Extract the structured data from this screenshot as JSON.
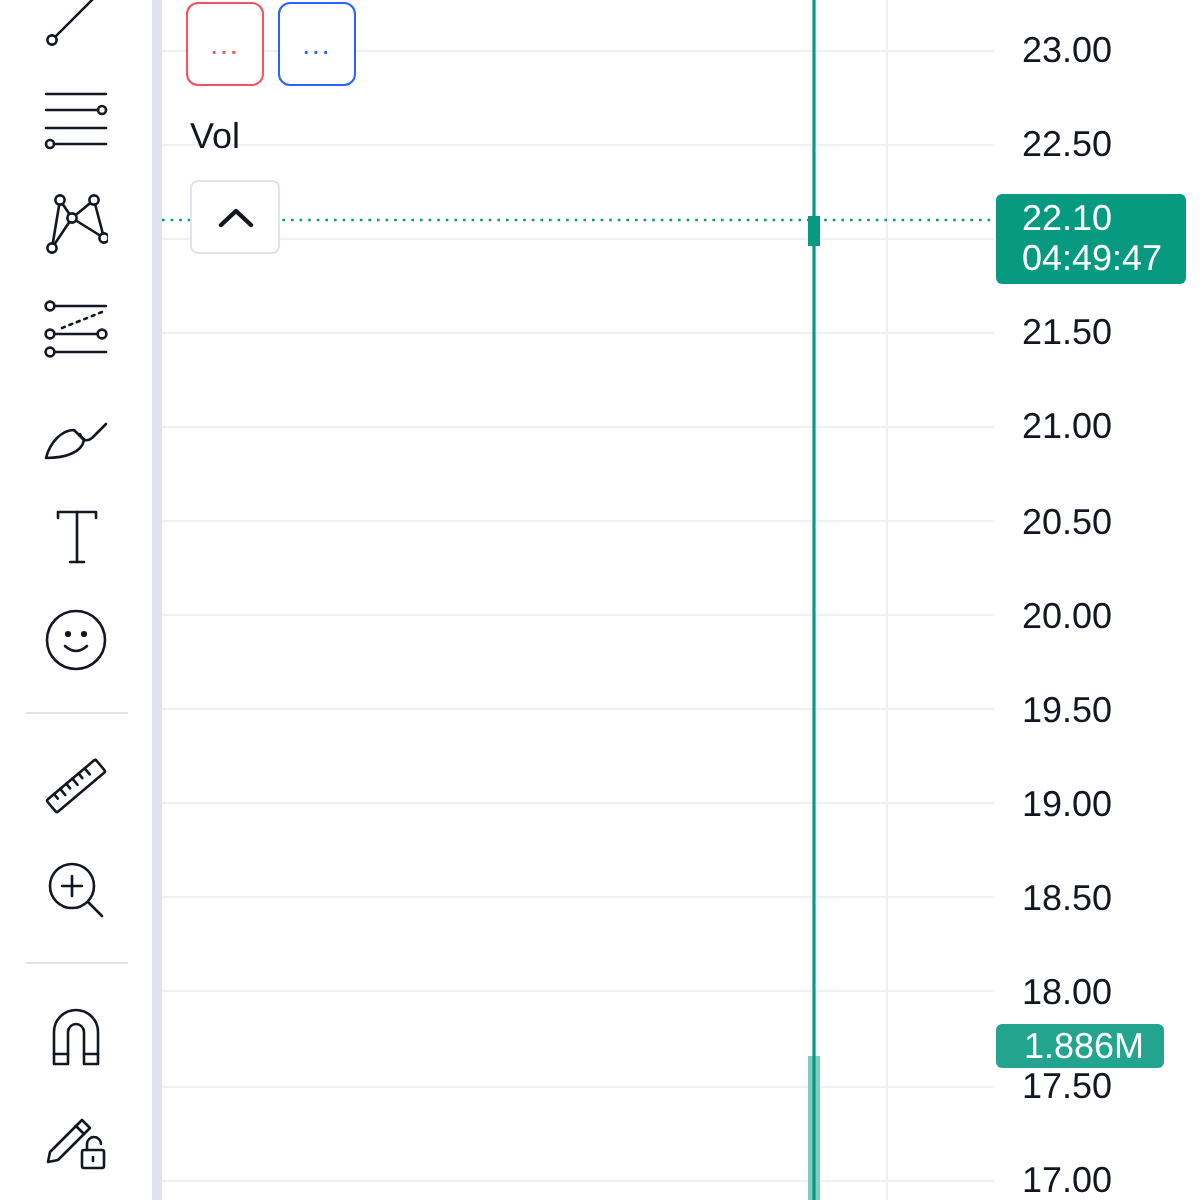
{
  "legend": {
    "buttons": [
      {
        "label": "...",
        "color": "#f7525f"
      },
      {
        "label": "...",
        "color": "#2962ff"
      }
    ],
    "title": "Vol"
  },
  "price_axis": [
    {
      "kind": "tick",
      "label": "23.00"
    },
    {
      "kind": "tick",
      "label": "22.50"
    },
    {
      "kind": "last_price",
      "price": "22.10",
      "time": "04:49:47"
    },
    {
      "kind": "tick",
      "label": "21.50"
    },
    {
      "kind": "tick",
      "label": "21.00"
    },
    {
      "kind": "tick",
      "label": "20.50"
    },
    {
      "kind": "tick",
      "label": "20.00"
    },
    {
      "kind": "tick",
      "label": "19.50"
    },
    {
      "kind": "tick",
      "label": "19.00"
    },
    {
      "kind": "tick",
      "label": "18.50"
    },
    {
      "kind": "tick",
      "label": "18.00"
    },
    {
      "kind": "tick",
      "label": "17.50"
    },
    {
      "kind": "tick",
      "label": "17.00"
    }
  ],
  "volume_tag": "1.886M"
}
